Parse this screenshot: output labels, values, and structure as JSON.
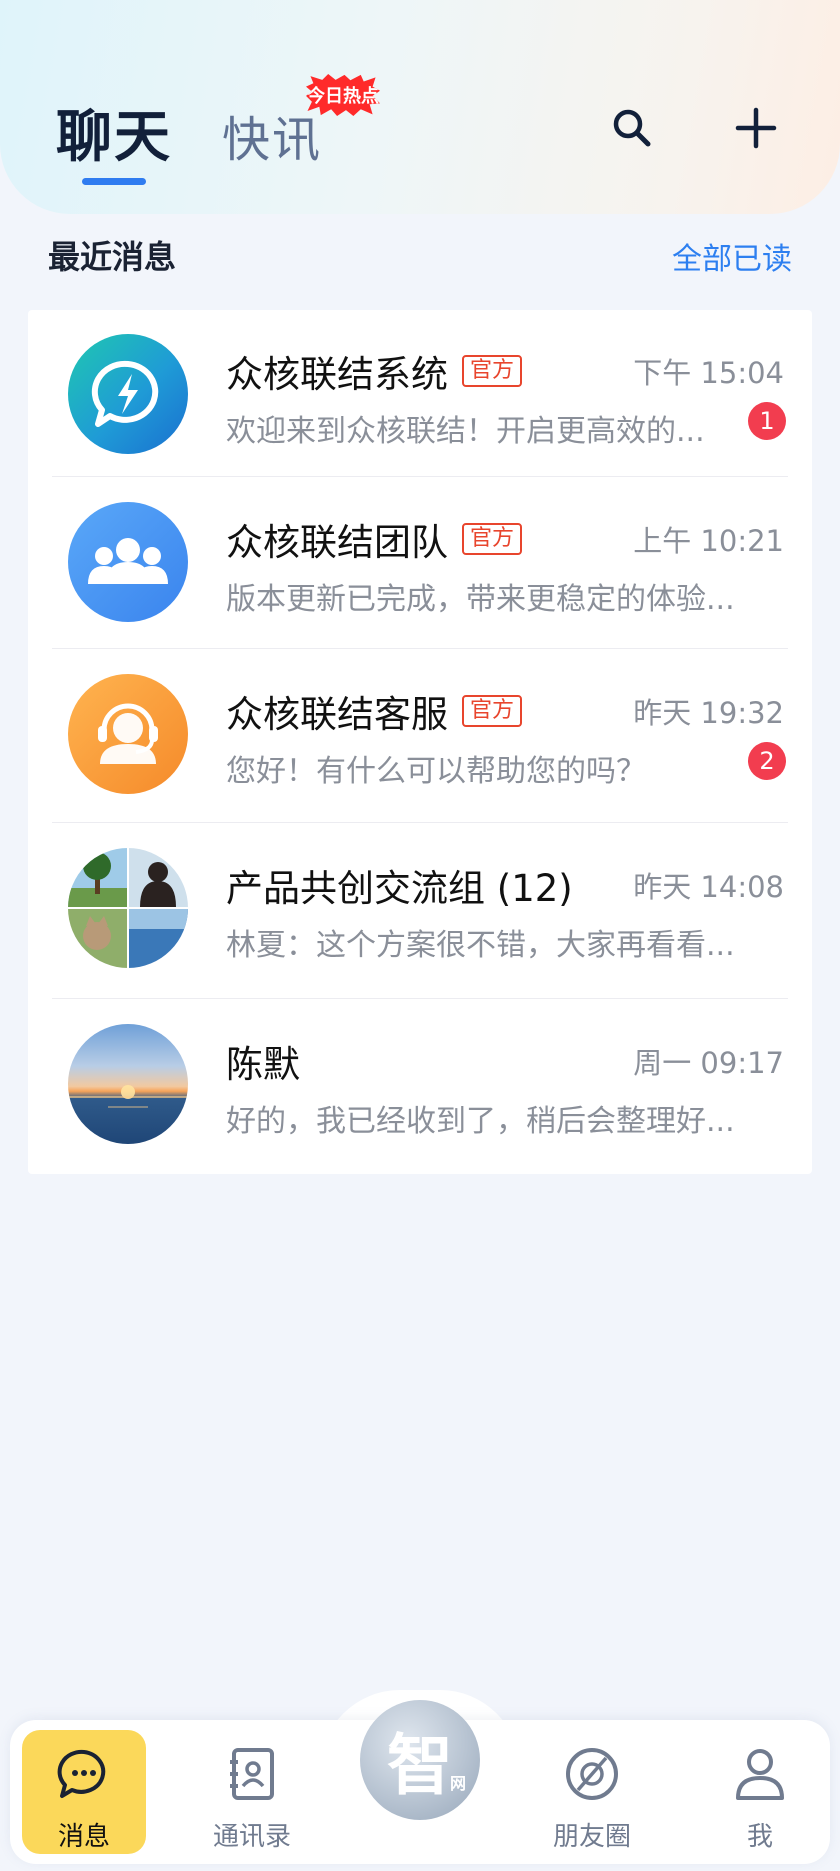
{
  "header": {
    "tab_chat": "聊天",
    "tab_news": "快讯",
    "hot_badge": "今日热点",
    "search_icon": "search-icon",
    "add_icon": "plus-icon"
  },
  "section": {
    "title": "最近消息",
    "read_all": "全部已读"
  },
  "conversations": [
    {
      "name": "众核联结系统",
      "tag": "官方",
      "time": "下午 15:04",
      "preview": "欢迎来到众核联结！开启更高效的...",
      "unread": "1",
      "avatar": "lightning-chat-icon"
    },
    {
      "name": "众核联结团队",
      "tag": "官方",
      "time": "上午 10:21",
      "preview": "版本更新已完成，带来更稳定的体验...",
      "unread": "",
      "avatar": "team-icon"
    },
    {
      "name": "众核联结客服",
      "tag": "官方",
      "time": "昨天 19:32",
      "preview": "您好！有什么可以帮助您的吗？",
      "unread": "2",
      "avatar": "headset-icon"
    },
    {
      "name": "产品共创交流组 (12)",
      "tag": "",
      "time": "昨天 14:08",
      "preview": "林夏：这个方案很不错，大家再看看...",
      "unread": "",
      "avatar": "group-collage"
    },
    {
      "name": "陈默",
      "tag": "",
      "time": "周一 09:17",
      "preview": "好的，我已经收到了，稍后会整理好...",
      "unread": "",
      "avatar": "sunset-photo"
    }
  ],
  "nav": {
    "messages": "消息",
    "contacts": "通讯录",
    "center_logo": "智",
    "center_logo_sub": "网",
    "moments": "朋友圈",
    "me": "我"
  },
  "colors": {
    "accent": "#2f7cf0",
    "active_nav": "#fbd85a",
    "unread_badge": "#f23d4f",
    "official_tag": "#e8452d"
  }
}
